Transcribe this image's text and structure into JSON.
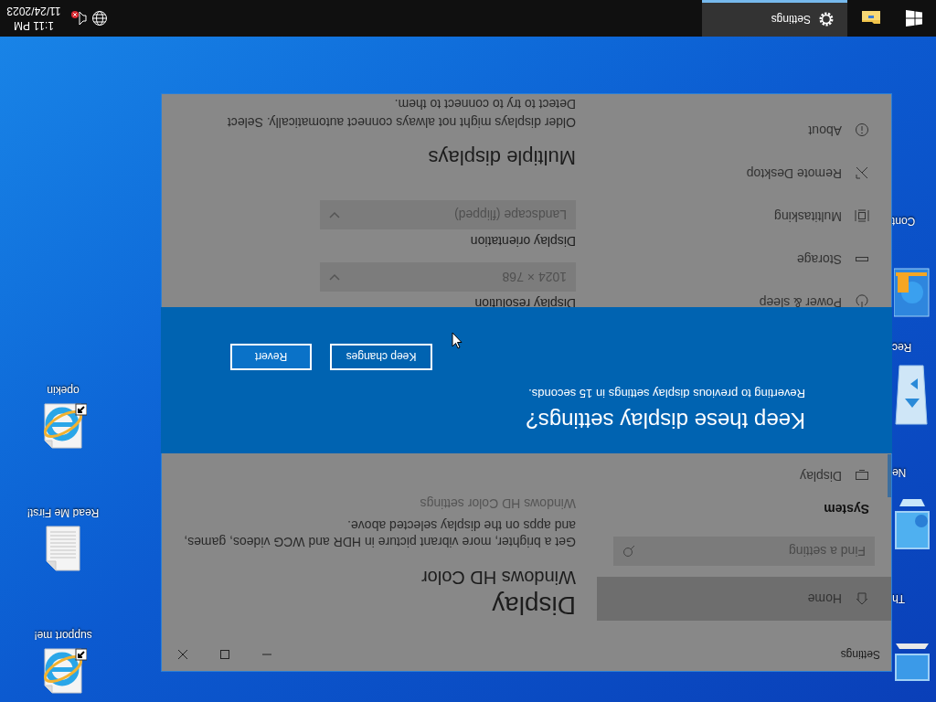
{
  "flipped": true,
  "desktop": {
    "icons": [
      {
        "label": "support me!",
        "kind": "web-shortcut"
      },
      {
        "label": "Read Me First!",
        "kind": "document"
      },
      {
        "label": "opekin",
        "kind": "web-shortcut"
      }
    ],
    "partial_icons": [
      {
        "label": "Th",
        "kind": "computer"
      },
      {
        "label": "Ne",
        "kind": "network"
      },
      {
        "label": "Rec",
        "kind": "recycle-bin"
      },
      {
        "label": "Cont",
        "kind": "control-panel"
      }
    ]
  },
  "settings_window": {
    "title": "Settings",
    "sidebar": {
      "home": {
        "label": "Home",
        "hovered": true
      },
      "search": {
        "placeholder": "Find a setting"
      },
      "section": "System",
      "items": [
        {
          "label": "Display",
          "selected": true
        },
        {
          "label": "Power & sleep",
          "selected": false
        },
        {
          "label": "Storage",
          "selected": false
        },
        {
          "label": "Multitasking",
          "selected": false
        },
        {
          "label": "Remote Desktop",
          "selected": false
        },
        {
          "label": "About",
          "selected": false
        }
      ]
    },
    "content": {
      "title": "Display",
      "hd_color": {
        "heading": "Windows HD Color",
        "description": "Get a brighter, more vibrant picture in HDR and WCG videos, games, and apps on the display selected above.",
        "link": "Windows HD Color settings"
      },
      "resolution": {
        "label": "Display resolution",
        "value": "1024 × 768"
      },
      "orientation": {
        "label": "Display orientation",
        "value": "Landscape (flipped)"
      },
      "multiple_displays": {
        "heading": "Multiple displays",
        "description": "Older displays might not always connect automatically. Select Detect to try to connect to them."
      }
    }
  },
  "dialog": {
    "title": "Keep these display settings?",
    "message": "Reverting to previous display settings in 15 seconds.",
    "buttons": [
      "Keep changes",
      "Revert"
    ]
  },
  "taskbar": {
    "apps": [
      {
        "kind": "file-explorer",
        "active": false
      },
      {
        "kind": "settings",
        "label": "Settings",
        "active": true
      }
    ],
    "audio_error": true,
    "clock": {
      "time": "1:11 PM",
      "date": "11/24/2023"
    }
  }
}
